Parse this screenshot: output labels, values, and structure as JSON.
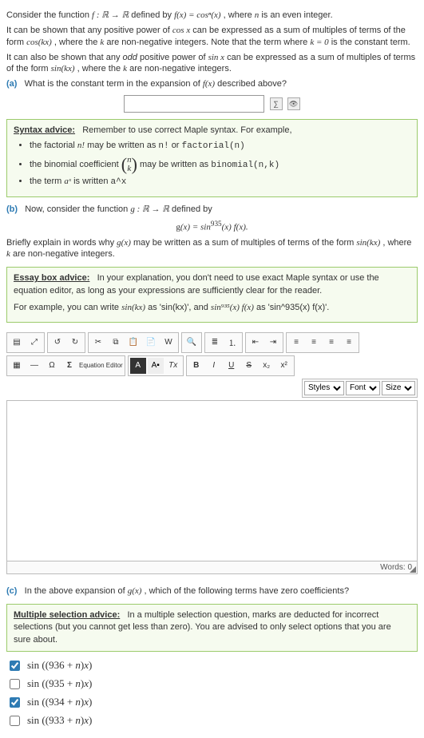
{
  "intro": {
    "line1_pre": "Consider the function ",
    "f_def": "f : ℝ → ℝ",
    "line1_mid": " defined by ",
    "f_eq": "f(x) = cosⁿ(x)",
    "line1_post": ", where ",
    "n": "n",
    "line1_end": " is an even integer."
  },
  "para2": {
    "t1": "It can be shown that any positive power of ",
    "cos": "cos x",
    "t2": " can be expressed as a sum of multiples of terms of the form ",
    "coskx": "cos(kx)",
    "t3": ", where the ",
    "k": "k",
    "t4": " are non-negative integers. Note that the term where ",
    "k0": "k = 0",
    "t5": " is the constant term."
  },
  "para3": {
    "t1": "It can also be shown that any ",
    "odd": "odd",
    "t2": " positive power of ",
    "sin": "sin x",
    "t3": " can be expressed as a sum of multiples of terms of the form ",
    "sinkx": "sin(kx)",
    "t4": ", where the ",
    "k": "k",
    "t5": " are non-negative integers."
  },
  "parts": {
    "a": {
      "label": "(a)",
      "text": "What is the constant term in the expansion of ",
      "fx": "f(x)",
      "text2": " described above?"
    },
    "b": {
      "label": "(b)",
      "text": "Now, consider the function ",
      "gdef": "g : ℝ → ℝ",
      "text2": " defined by",
      "eq": "g(x) = sin⁹³⁵(x) f(x).",
      "brief1": "Briefly explain in words why ",
      "gx": "g(x)",
      "brief2": " may be written as a sum of multiples of terms of the form ",
      "sinkx": "sin(kx)",
      "brief3": ", where ",
      "k": "k",
      "brief4": " are non-negative integers."
    },
    "c": {
      "label": "(c)",
      "text": "In the above expansion of ",
      "gx": "g(x)",
      "text2": ", which of the following terms have zero coefficients?"
    }
  },
  "syntax_box": {
    "title": "Syntax advice:",
    "intro": "Remember to use correct Maple syntax. For example,",
    "li1a": "the factorial ",
    "li1_math": "n!",
    "li1b": " may be written as ",
    "li1_code1": "n!",
    "li1_or": " or ",
    "li1_code2": "factorial(n)",
    "li2a": "the binomial coefficient ",
    "li2b": " may be written as ",
    "li2_code": "binomial(n,k)",
    "li3a": "the term ",
    "li3_math": "aˣ",
    "li3b": " is written ",
    "li3_code": "a^x"
  },
  "essay_box": {
    "title": "Essay box advice:",
    "l1": "In your explanation, you don't need to use exact Maple syntax or use the equation editor, as long as your expressions are sufficiently clear for the reader.",
    "l2a": "For example, you can write ",
    "m1": "sin(kx)",
    "l2b": " as 'sin(kx)', and ",
    "m2": "sin⁹³⁵(x) f(x)",
    "l2c": " as 'sin^935(x) f(x)'."
  },
  "multi_box": {
    "title": "Multiple selection advice:",
    "t1": "In a multiple selection question, marks are deducted for incorrect selections (but you cannot get less than zero). You are advised to only select options that you are sure about."
  },
  "options": [
    {
      "label": "sin ((936 + n)x)",
      "checked": true
    },
    {
      "label": "sin ((935 + n)x)",
      "checked": false
    },
    {
      "label": "sin ((934 + n)x)",
      "checked": true
    },
    {
      "label": "sin ((933 + n)x)",
      "checked": false
    }
  ],
  "editor": {
    "eq_label": "Equation Editor",
    "styles": "Styles",
    "font": "Font",
    "size": "Size",
    "words_label": "Words: ",
    "words_count": "0",
    "btn_A": "A",
    "btn_T": "Tx",
    "btn_B": "B",
    "btn_I": "I",
    "btn_U": "U",
    "btn_S": "S",
    "btn_sub": "x₂",
    "btn_sup": "x²"
  }
}
